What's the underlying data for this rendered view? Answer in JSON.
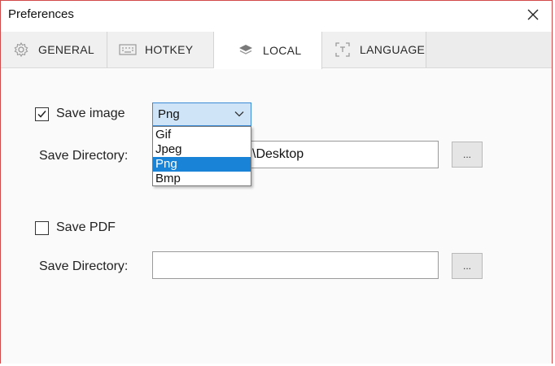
{
  "window": {
    "title": "Preferences",
    "border_color": "#d24a4a"
  },
  "tabs": [
    {
      "label": "GENERAL",
      "icon": "gear-icon",
      "active": false
    },
    {
      "label": "HOTKEY",
      "icon": "keyboard-icon",
      "active": false
    },
    {
      "label": "LOCAL",
      "icon": "layers-icon",
      "active": true
    },
    {
      "label": "LANGUAGE",
      "icon": "text-recognize-icon",
      "active": false
    }
  ],
  "local": {
    "save_image": {
      "label": "Save image",
      "checked": true,
      "format_selected": "Png",
      "format_options": [
        "Gif",
        "Jpeg",
        "Png",
        "Bmp"
      ],
      "dropdown_open": true,
      "directory_label": "Save Directory:",
      "directory_value": "\\Desktop",
      "browse_label": "..."
    },
    "save_pdf": {
      "label": "Save PDF",
      "checked": false,
      "directory_label": "Save Directory:",
      "directory_value": "",
      "browse_label": "..."
    }
  },
  "colors": {
    "accent": "#1883d7",
    "select_bg": "#cfe5f7",
    "select_border": "#3b8ad6"
  }
}
